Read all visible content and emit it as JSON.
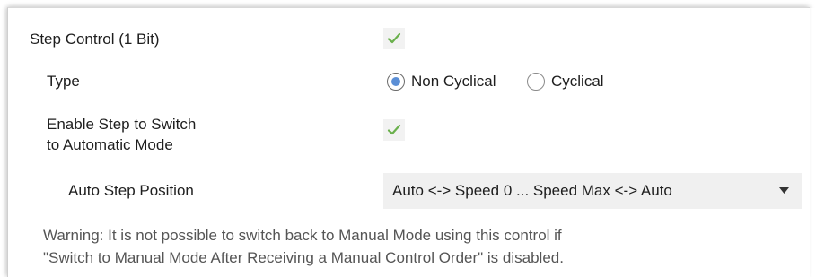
{
  "settings": {
    "step_control": {
      "label": "Step Control (1 Bit)",
      "checked": true
    },
    "type": {
      "label": "Type",
      "options": [
        "Non Cyclical",
        "Cyclical"
      ],
      "selected": "Non Cyclical"
    },
    "enable_step": {
      "label_line1": "Enable Step to Switch",
      "label_line2": "to Automatic Mode",
      "checked": true
    },
    "auto_step_position": {
      "label": "Auto Step Position",
      "value": "Auto <-> Speed 0 ... Speed Max <-> Auto"
    },
    "warning": {
      "line1": "Warning: It is not possible to switch back to Manual Mode using this control if",
      "line2": "\"Switch to Manual Mode After Receiving a Manual Control Order\" is disabled."
    }
  },
  "colors": {
    "checkmark": "#6ab04c",
    "radio_dot": "#5b8fd6",
    "control_bg": "#f0f0f0",
    "warning_text": "#555555"
  },
  "icons": {
    "checkbox": "checkmark-icon",
    "dropdown": "chevron-down-icon"
  }
}
